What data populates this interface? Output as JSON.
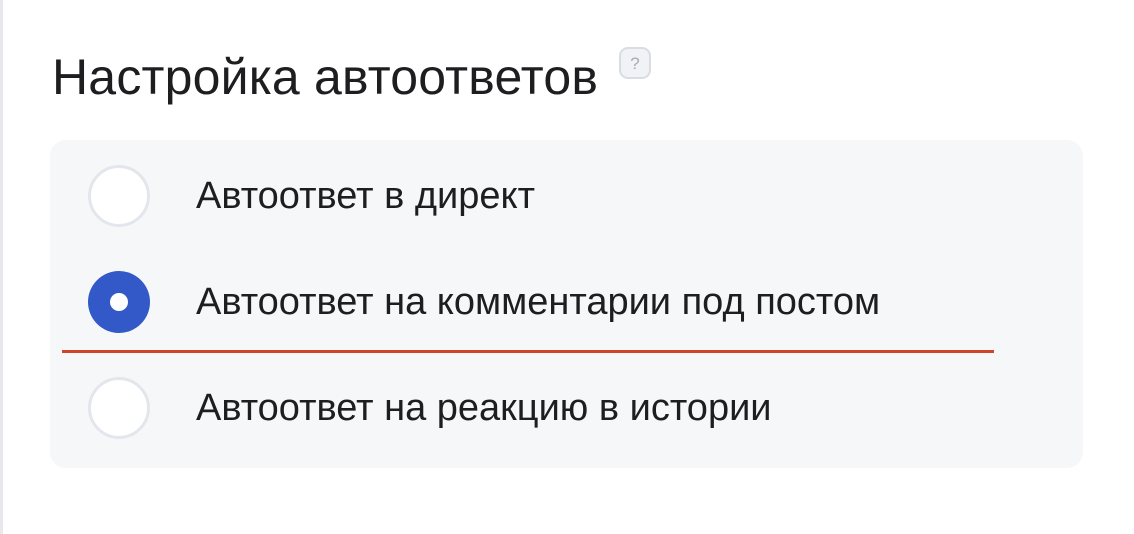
{
  "title": "Настройка автоответов",
  "help_icon": "question-mark-icon",
  "options": [
    {
      "label": "Автоответ в директ",
      "selected": false
    },
    {
      "label": "Автоответ на комментарии под постом",
      "selected": true
    },
    {
      "label": "Автоответ на реакцию в истории",
      "selected": false
    }
  ],
  "colors": {
    "panel_background": "#f6f7f9",
    "radio_selected": "#3259c7",
    "underline": "#d0442c",
    "text": "#1e1e20"
  }
}
